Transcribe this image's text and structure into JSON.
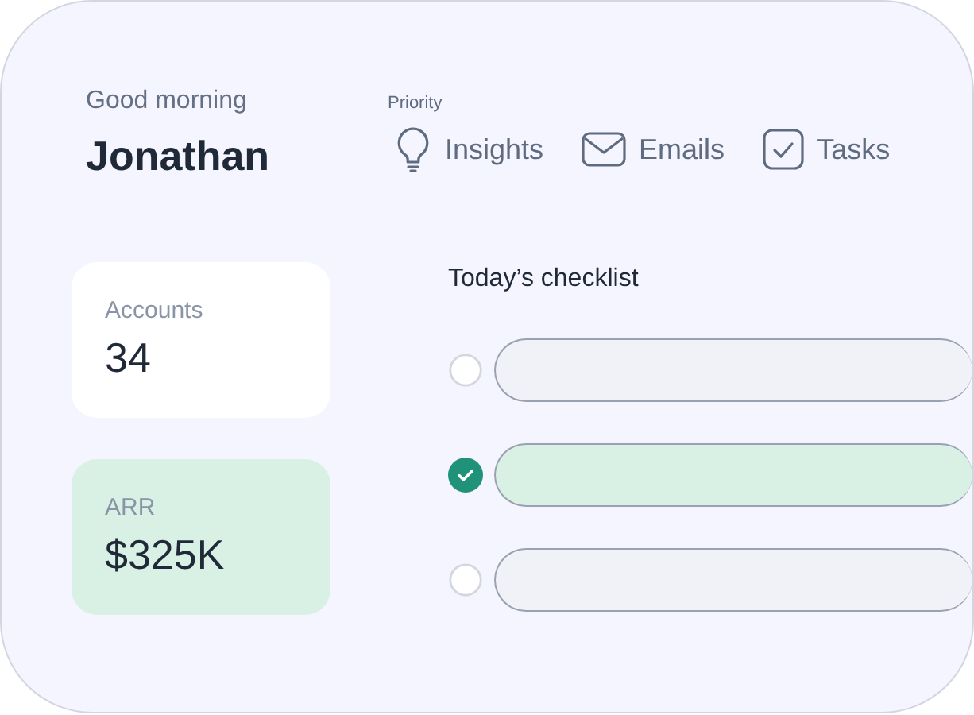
{
  "greeting": {
    "subtitle": "Good morning",
    "name": "Jonathan"
  },
  "priority": {
    "label": "Priority",
    "items": [
      {
        "kind": "bulb",
        "label": "Insights"
      },
      {
        "kind": "mail",
        "label": "Emails"
      },
      {
        "kind": "checkbox",
        "label": "Tasks"
      }
    ]
  },
  "stats": [
    {
      "label": "Accounts",
      "value": "34",
      "color": "#ffffff"
    },
    {
      "label": "ARR",
      "value": "$325K",
      "color": "#d8f1e4"
    }
  ],
  "checklist": {
    "title": "Today’s checklist",
    "items": [
      {
        "checked": false
      },
      {
        "checked": true
      },
      {
        "checked": false
      }
    ]
  }
}
